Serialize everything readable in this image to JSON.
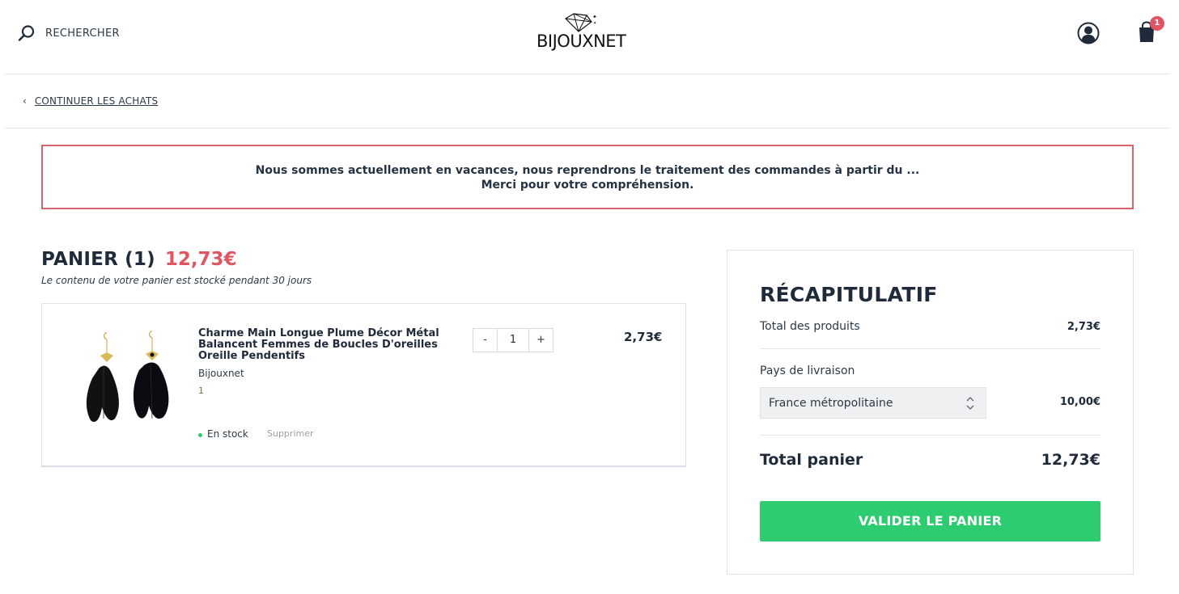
{
  "header": {
    "search_label": "RECHERCHER",
    "logo_text": "BIJOUXNET",
    "cart_count": "1"
  },
  "nav": {
    "continue_label": "CONTINUER LES ACHATS"
  },
  "notice": {
    "line1": "Nous sommes actuellement en vacances, nous reprendrons le traitement des commandes à partir du ...",
    "line2": "Merci pour votre compréhension."
  },
  "cart": {
    "title": "PANIER (1)",
    "total": "12,73€",
    "note": "Le contenu de votre panier est stocké pendant 30 jours",
    "items": [
      {
        "name": "Charme Main Longue Plume Décor Métal Balancent Femmes de Boucles D'oreilles Oreille Pendentifs",
        "brand": "Bijouxnet",
        "ref": "1",
        "quantity": "1",
        "qty_minus": "-",
        "qty_plus": "+",
        "price": "2,73€",
        "stock": "En stock",
        "remove": "Supprimer"
      }
    ]
  },
  "summary": {
    "title": "RÉCAPITULATIF",
    "products_label": "Total des produits",
    "products_value": "2,73€",
    "country_label": "Pays de livraison",
    "country_value": "France métropolitaine",
    "shipping_value": "10,00€",
    "total_label": "Total panier",
    "total_value": "12,73€",
    "validate_label": "VALIDER LE PANIER"
  },
  "colors": {
    "accent_red": "#e05561",
    "accent_green": "#2ecc71",
    "text_dark": "#1f2b3a"
  }
}
